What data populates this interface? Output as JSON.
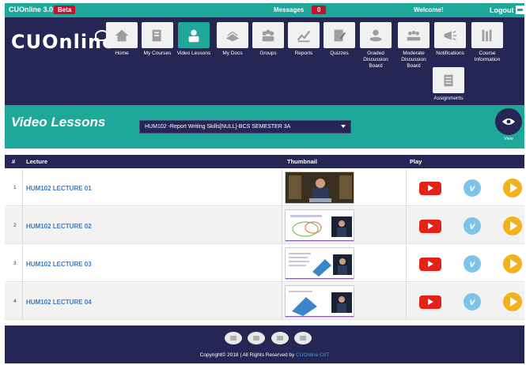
{
  "topbar": {
    "brand": "CUOnline 3.0",
    "beta": "Beta",
    "messages_label": "Messages",
    "messages_count": "0",
    "welcome": "Welcome!",
    "logout": "Logout"
  },
  "header": {
    "logo": "CUOnline",
    "nav": [
      {
        "label": "Home",
        "icon": "home-icon"
      },
      {
        "label": "My Courses",
        "icon": "courses-icon"
      },
      {
        "label": "Video Lessons",
        "icon": "video-lessons-icon"
      },
      {
        "label": "My Docs",
        "icon": "docs-icon"
      },
      {
        "label": "Groups",
        "icon": "groups-icon"
      },
      {
        "label": "Reports",
        "icon": "reports-icon"
      },
      {
        "label": "Quizzes",
        "icon": "quizzes-icon"
      },
      {
        "label": "Graded Discussion Board",
        "icon": "graded-discussion-icon"
      },
      {
        "label": "Moderate Discussion Board",
        "icon": "moderate-discussion-icon"
      },
      {
        "label": "Notifications",
        "icon": "notifications-icon"
      },
      {
        "label": "Course Information",
        "icon": "course-info-icon"
      },
      {
        "label": "Assignments",
        "icon": "assignments-icon"
      }
    ]
  },
  "titleband": {
    "title": "Video Lessons",
    "course_selected": "HUM102 -Report Writing Skills[NULL]-BCS SEMESTER 3A",
    "view_label": "View"
  },
  "table": {
    "headers": {
      "num": "#",
      "lecture": "Lecture",
      "thumbnail": "Thumbnail",
      "play": "Play"
    },
    "rows": [
      {
        "num": "1",
        "lecture": "HUM102 LECTURE 01"
      },
      {
        "num": "2",
        "lecture": "HUM102 LECTURE 02"
      },
      {
        "num": "3",
        "lecture": "HUM102 LECTURE 03"
      },
      {
        "num": "4",
        "lecture": "HUM102 LECTURE 04"
      }
    ]
  },
  "footer": {
    "copyright": "Copyright© 2018 | All Rights Reserved by",
    "copyright_link": "CUOnline CIIT"
  },
  "colors": {
    "teal": "#1fa79a",
    "navy": "#252654",
    "youtube_red": "#e62117",
    "vimeo_blue": "#7fc2e9",
    "play_yellow": "#f0b31e",
    "link_blue": "#3b79c4"
  }
}
